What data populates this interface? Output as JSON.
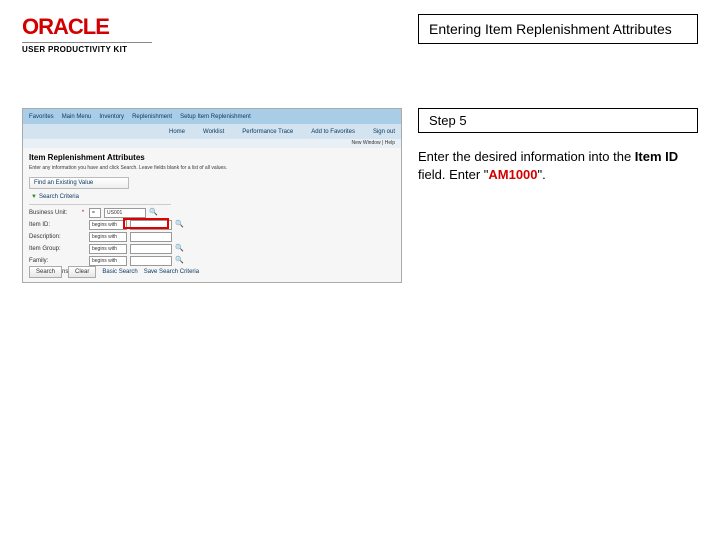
{
  "brand": {
    "name": "ORACLE",
    "product_line": "USER PRODUCTIVITY KIT"
  },
  "title": "Entering Item Replenishment Attributes",
  "step": "Step 5",
  "instruction": {
    "lead": "Enter the desired information into the ",
    "field_name": "Item ID",
    "mid": " field. Enter \"",
    "entry_value": "AM1000",
    "tail": "\"."
  },
  "app": {
    "topnav": [
      "Favorites",
      "Main Menu",
      "Inventory",
      "Replenishment",
      "Setup Item Replenishment"
    ],
    "subnav": [
      "Home",
      "Worklist",
      "Performance Trace",
      "Add to Favorites",
      "Sign out"
    ],
    "underbar": "New Window | Help",
    "panel_title": "Item Replenishment Attributes",
    "panel_sub": "Enter any information you have and click Search. Leave fields blank for a list of all values.",
    "tab": "Find an Existing Value",
    "section": "Search Criteria",
    "rows": [
      {
        "label": "Business Unit:",
        "required": true,
        "value": "US001",
        "op": "="
      },
      {
        "label": "Item ID:",
        "required": false,
        "value": "",
        "op": "begins with"
      },
      {
        "label": "Description:",
        "required": false,
        "value": "",
        "op": "begins with"
      },
      {
        "label": "Item Group:",
        "required": false,
        "value": "",
        "op": "begins with"
      },
      {
        "label": "Family:",
        "required": false,
        "value": "",
        "op": "begins with"
      }
    ],
    "checkbox": "Case Sensitive",
    "buttons": {
      "search": "Search",
      "clear": "Clear",
      "basic": "Basic Search",
      "save": "Save Search Criteria"
    }
  }
}
